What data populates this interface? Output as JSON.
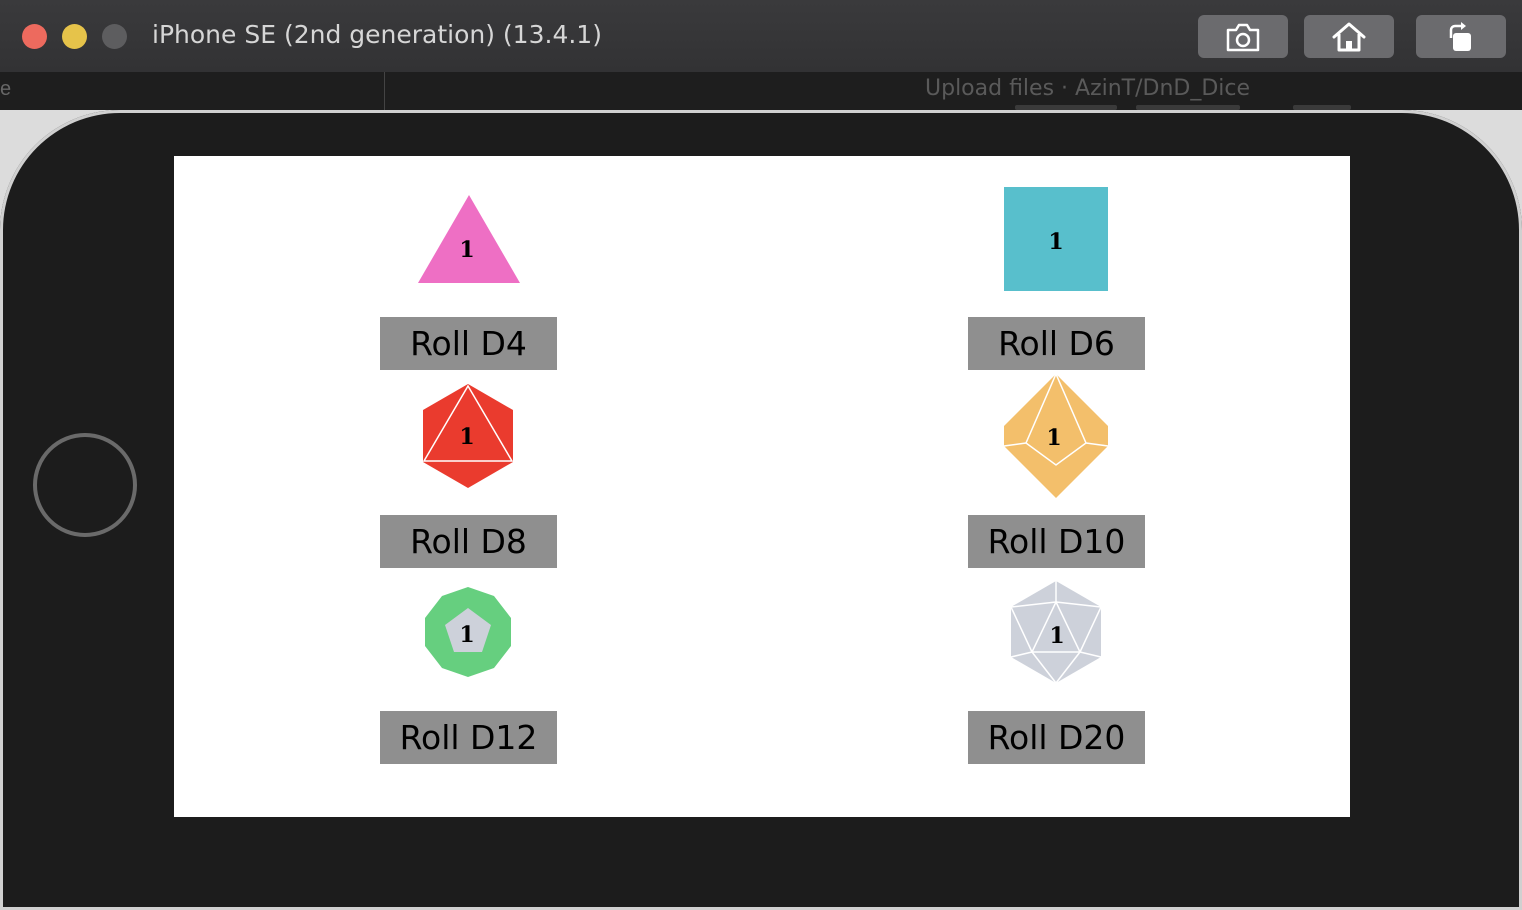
{
  "window": {
    "title": "iPhone SE (2nd generation) (13.4.1)",
    "toolbar_buttons": [
      {
        "name": "screenshot",
        "icon": "camera-icon"
      },
      {
        "name": "home",
        "icon": "home-icon"
      },
      {
        "name": "rotate",
        "icon": "rotate-icon"
      }
    ]
  },
  "background_window": {
    "title": "Upload files · AzinT/DnD_Dice",
    "left_fragment": "e"
  },
  "dice": [
    {
      "id": "d4",
      "value": "1",
      "color": "#ee6fc4",
      "button_label": "Roll D4"
    },
    {
      "id": "d6",
      "value": "1",
      "color": "#58bfcc",
      "button_label": "Roll D6"
    },
    {
      "id": "d8",
      "value": "1",
      "color": "#ea3b2e",
      "button_label": "Roll D8"
    },
    {
      "id": "d10",
      "value": "1",
      "color": "#f3bf6b",
      "button_label": "Roll D10"
    },
    {
      "id": "d12",
      "value": "1",
      "color": "#66cf7f",
      "face_color": "#cdd1da",
      "button_label": "Roll D12"
    },
    {
      "id": "d20",
      "value": "1",
      "color": "#cdd1da",
      "button_label": "Roll D20"
    }
  ]
}
